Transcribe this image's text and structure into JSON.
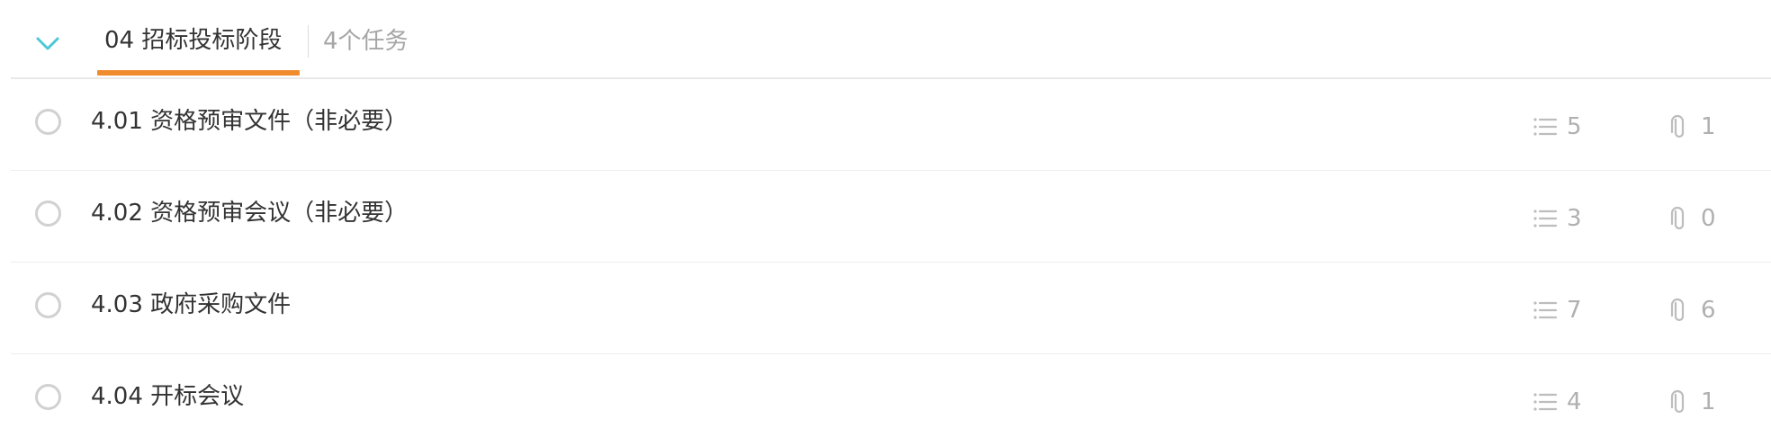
{
  "section": {
    "title": "04 招标投标阶段",
    "task_count_label": "4个任务",
    "accent_color": "#f08c2e",
    "chevron_color": "#4cc8d6"
  },
  "tasks": [
    {
      "title": "4.01 资格预审文件（非必要）",
      "checklist_count": "5",
      "attachment_count": "1"
    },
    {
      "title": "4.02 资格预审会议（非必要）",
      "checklist_count": "3",
      "attachment_count": "0"
    },
    {
      "title": "4.03 政府采购文件",
      "checklist_count": "7",
      "attachment_count": "6"
    },
    {
      "title": "4.04 开标会议",
      "checklist_count": "4",
      "attachment_count": "1"
    }
  ],
  "icons": {
    "collapse": "chevron-down-icon",
    "checkbox": "circle-checkbox-icon",
    "checklist": "list-icon",
    "attachment": "paperclip-icon"
  }
}
